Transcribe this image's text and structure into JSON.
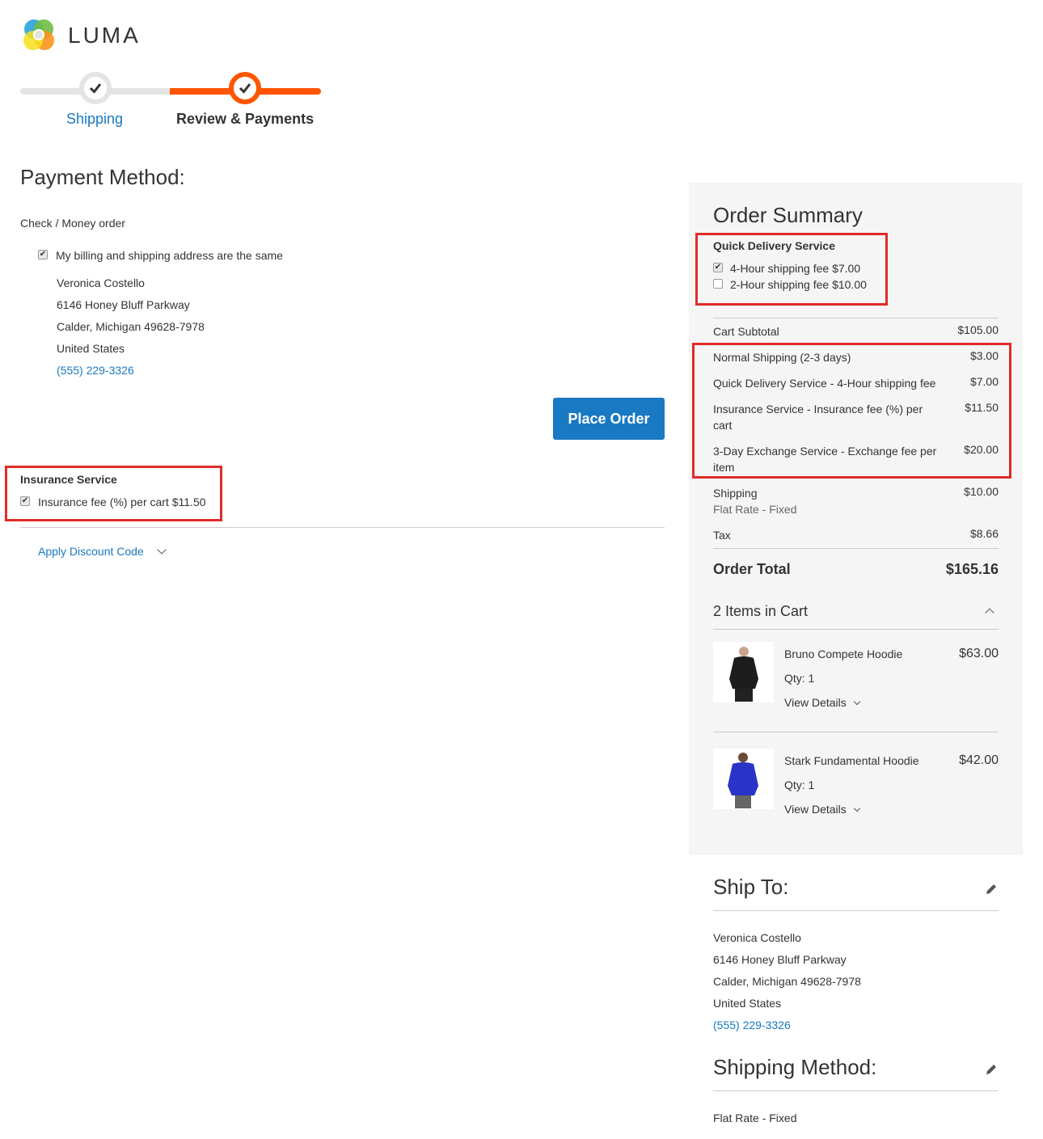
{
  "brand": {
    "name": "LUMA"
  },
  "progress": {
    "steps": [
      {
        "label": "Shipping",
        "state": "complete"
      },
      {
        "label": "Review & Payments",
        "state": "active"
      }
    ]
  },
  "payment": {
    "title": "Payment Method:",
    "method_label": "Check / Money order",
    "same_address_label": "My billing and shipping address are the same",
    "same_address_checked": true,
    "address": {
      "name": "Veronica Costello",
      "street": "6146 Honey Bluff Parkway",
      "city_line": "Calder, Michigan 49628-7978",
      "country": "United States",
      "phone": "(555) 229-3326"
    },
    "place_order_label": "Place Order"
  },
  "insurance": {
    "title": "Insurance Service",
    "option_label": "Insurance fee (%) per cart $11.50",
    "checked": true
  },
  "discount": {
    "label": "Apply Discount Code"
  },
  "summary": {
    "title": "Order Summary",
    "quick_delivery": {
      "title": "Quick Delivery Service",
      "options": [
        {
          "label": "4-Hour shipping fee $7.00",
          "checked": true
        },
        {
          "label": "2-Hour shipping fee $10.00",
          "checked": false
        }
      ]
    },
    "rows": {
      "subtotal": {
        "label": "Cart Subtotal",
        "value": "$105.00"
      },
      "normal": {
        "label": "Normal Shipping (2-3 days)",
        "value": "$3.00"
      },
      "quick": {
        "label": "Quick Delivery Service - 4-Hour shipping fee",
        "value": "$7.00"
      },
      "insurance": {
        "label": "Insurance Service - Insurance fee (%) per cart",
        "value": "$11.50"
      },
      "exchange": {
        "label": "3-Day Exchange Service - Exchange fee per item",
        "value": "$20.00"
      },
      "shipping": {
        "label": "Shipping",
        "sub": "Flat Rate - Fixed",
        "value": "$10.00"
      },
      "tax": {
        "label": "Tax",
        "value": "$8.66"
      }
    },
    "order_total": {
      "label": "Order Total",
      "value": "$165.16"
    },
    "items_count_label": "2 Items in Cart",
    "items": [
      {
        "name": "Bruno Compete Hoodie",
        "price": "$63.00",
        "qty": "Qty: 1",
        "details": "View Details",
        "color": "#1d1d1d"
      },
      {
        "name": "Stark Fundamental Hoodie",
        "price": "$42.00",
        "qty": "Qty: 1",
        "details": "View Details",
        "color": "#2a33c8"
      }
    ]
  },
  "ship_to": {
    "title": "Ship To:",
    "address": {
      "name": "Veronica Costello",
      "street": "6146 Honey Bluff Parkway",
      "city_line": "Calder, Michigan 49628-7978",
      "country": "United States",
      "phone": "(555) 229-3326"
    }
  },
  "shipping_method": {
    "title": "Shipping Method:",
    "value": "Flat Rate - Fixed"
  },
  "colors": {
    "accent": "#1979c3",
    "progress": "#ff5501",
    "highlight": "#e02b27"
  }
}
